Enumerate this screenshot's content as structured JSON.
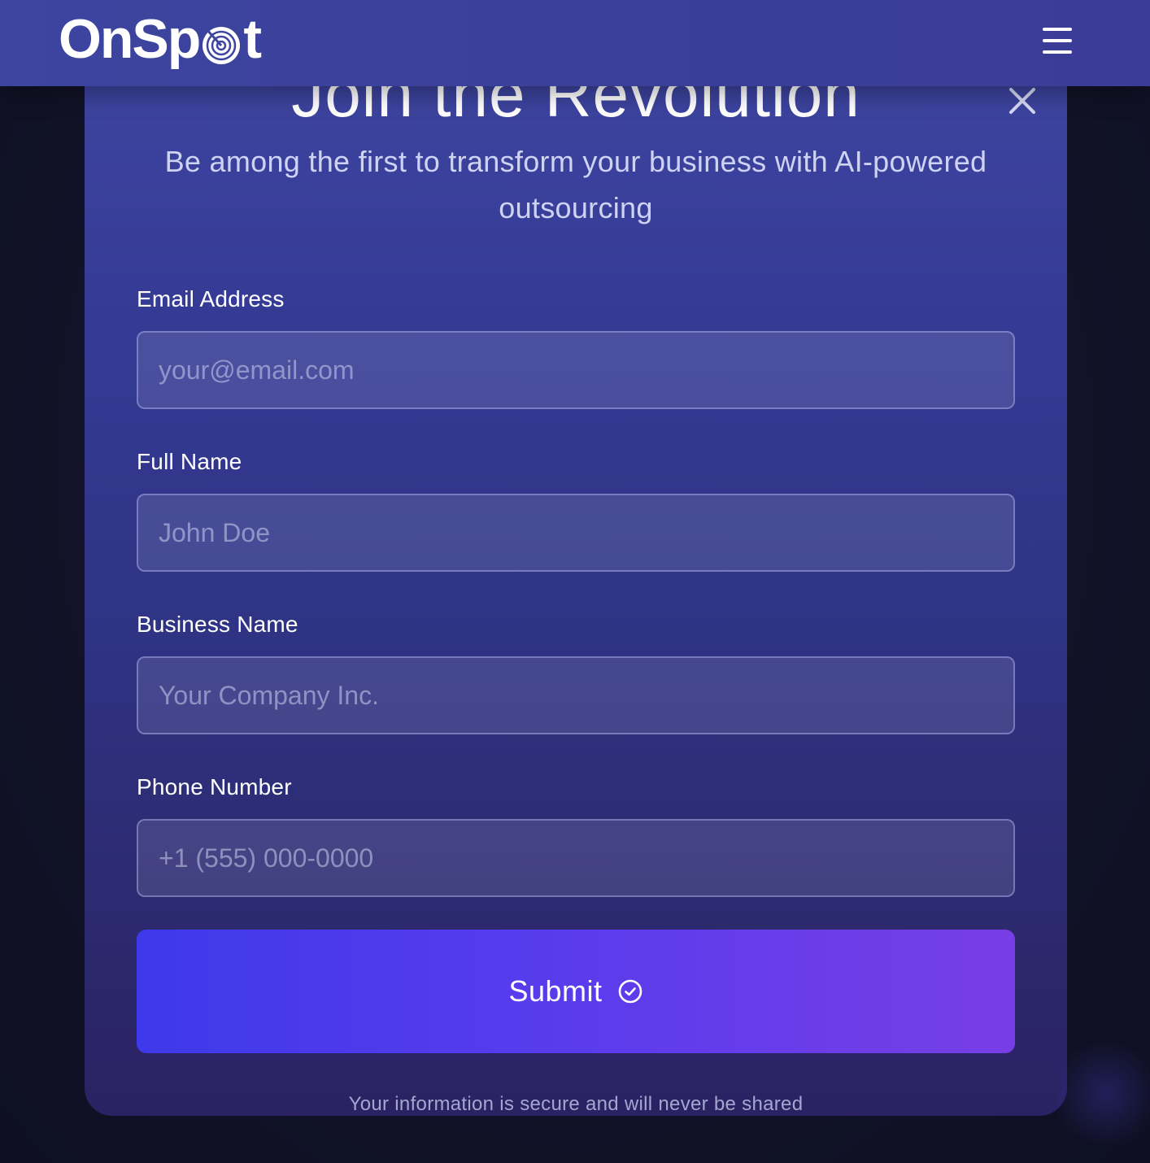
{
  "header": {
    "logo_text_left": "OnSp",
    "logo_text_right": "t",
    "logo_icon": "target-icon",
    "menu_icon": "hamburger-menu-icon"
  },
  "modal": {
    "title": "Join the Revolution",
    "close_icon": "close-icon",
    "subtitle": "Be among the first to transform your business with AI-powered outsourcing",
    "fields": {
      "email": {
        "label": "Email Address",
        "placeholder": "your@email.com",
        "value": ""
      },
      "name": {
        "label": "Full Name",
        "placeholder": "John Doe",
        "value": ""
      },
      "business": {
        "label": "Business Name",
        "placeholder": "Your Company Inc.",
        "value": ""
      },
      "phone": {
        "label": "Phone Number",
        "placeholder": "+1 (555) 000-0000",
        "value": ""
      }
    },
    "submit": {
      "label": "Submit",
      "icon": "check-circle-icon"
    },
    "footer_note": "Your information is secure and will never be shared"
  },
  "colors": {
    "accent_start": "#3e39ea",
    "accent_end": "#783ee6",
    "header_bg": "#3d45a0",
    "page_bg": "#12142a"
  }
}
